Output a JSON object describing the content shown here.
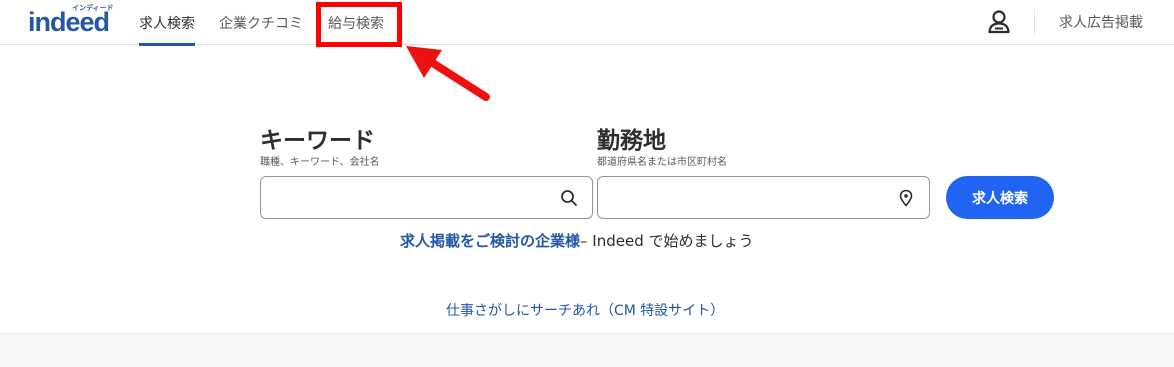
{
  "logo": {
    "text": "indeed",
    "kana": "インディード"
  },
  "nav": {
    "tabs": [
      {
        "label": "求人検索",
        "active": true
      },
      {
        "label": "企業クチコミ",
        "active": false
      },
      {
        "label": "給与検索",
        "active": false
      }
    ],
    "employer_link": "求人広告掲載"
  },
  "search": {
    "keyword": {
      "heading": "キーワード",
      "sub": "職種、キーワード、会社名",
      "value": ""
    },
    "location": {
      "heading": "勤務地",
      "sub": "都道府県名または市区町村名",
      "value": ""
    },
    "button_label": "求人検索"
  },
  "promo": {
    "link": "求人掲載をご検討の企業様",
    "rest": "– Indeed で始めましょう"
  },
  "cm_link": "仕事さがしにサーチあれ（CM 特設サイト）",
  "colors": {
    "brand": "#2557a7",
    "button": "#2164f3",
    "annotation": "#ff0000"
  },
  "icons": [
    "user-icon",
    "search-icon",
    "location-pin-icon"
  ]
}
